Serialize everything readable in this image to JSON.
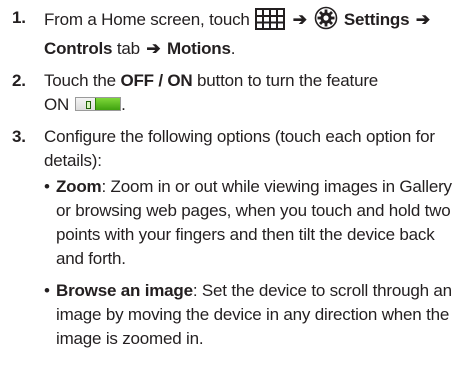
{
  "steps": [
    {
      "number": "1.",
      "text_before_icons": "From a Home screen, touch",
      "arrow_1": "➔",
      "settings_label": "Settings",
      "arrow_2": "➔",
      "controls_label": "Controls",
      "tab_word": "tab",
      "arrow_3": "➔",
      "motions_label": "Motions",
      "period": "."
    },
    {
      "number": "2.",
      "text_1": "Touch the",
      "button_label": "OFF / ON",
      "text_2": "button to turn the feature",
      "on_word": "ON",
      "period": "."
    },
    {
      "number": "3.",
      "text": "Configure the following options (touch each option for details):"
    }
  ],
  "options": [
    {
      "bullet": "•",
      "term": "Zoom",
      "description": ": Zoom in or out while viewing images in Gallery or browsing web pages, when you touch and hold two points with your fingers and then tilt the device back and forth."
    },
    {
      "bullet": "•",
      "term": "Browse an image",
      "description": ": Set the device to scroll through an image by moving the device in any direction when the image is zoomed in."
    }
  ],
  "icons": {
    "apps": "apps-grid-icon",
    "settings": "settings-gear-icon",
    "toggle": "on-toggle-icon"
  },
  "colors": {
    "text": "#231f20",
    "toggle_on": "#3fa20f"
  }
}
